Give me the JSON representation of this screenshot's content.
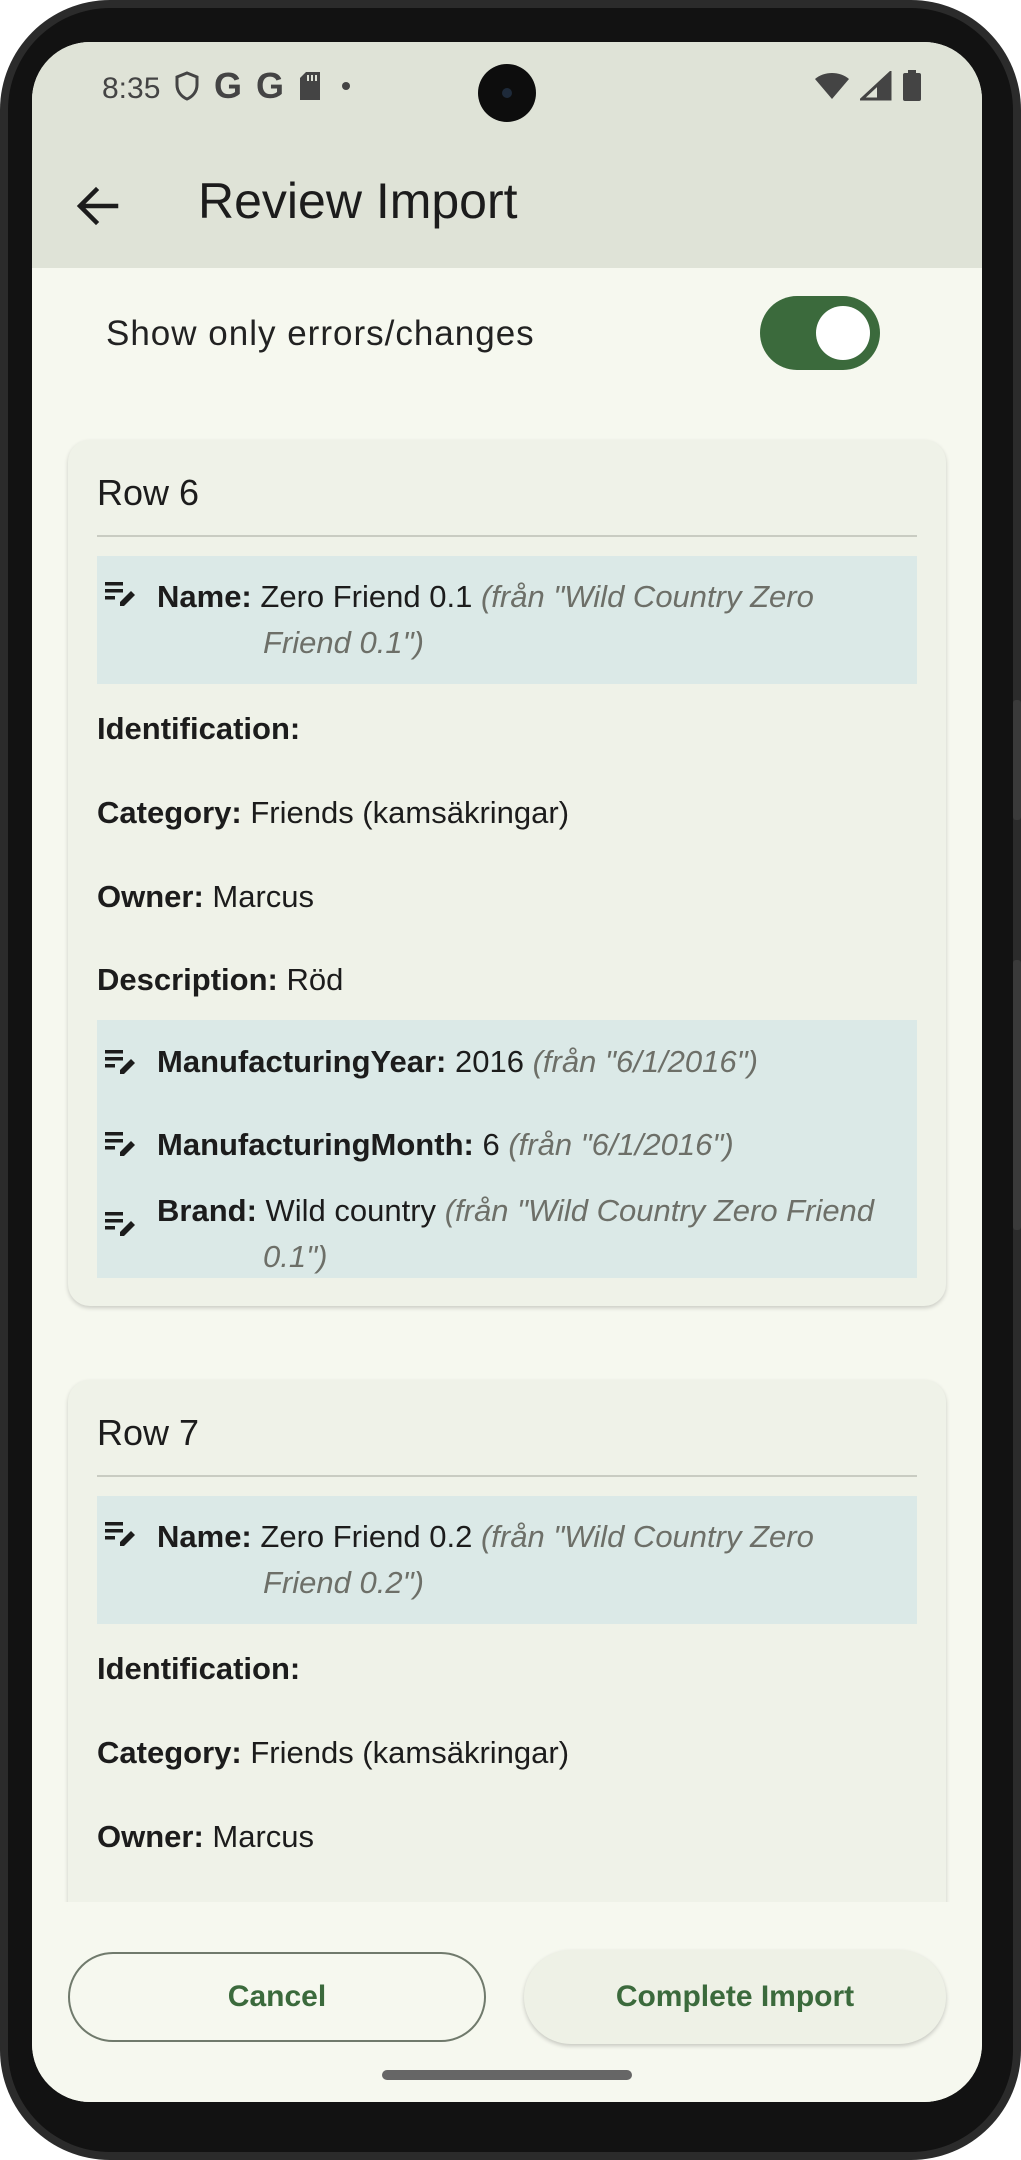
{
  "status_bar": {
    "time": "8:35",
    "left_icons": [
      "shield-icon",
      "google-icon",
      "google-icon",
      "sd-card-icon",
      "dot-icon"
    ],
    "right_icons": [
      "wifi-icon",
      "signal-icon",
      "battery-icon"
    ]
  },
  "app_bar": {
    "title": "Review Import",
    "back_icon": "arrow-back-icon"
  },
  "filter": {
    "label": "Show only errors/changes",
    "enabled": true,
    "accent_color": "#3b6a3c"
  },
  "rows": [
    {
      "title": "Row 6",
      "fields": [
        {
          "label": "Name:",
          "value": "Zero Friend 0.1",
          "original": "(från \"Wild Country Zero",
          "original_cont": "Friend 0.1\")",
          "changed": true
        },
        {
          "label": "Identification:",
          "value": "",
          "changed": false
        },
        {
          "label": "Category:",
          "value": "Friends (kamsäkringar)",
          "changed": false
        },
        {
          "label": "Owner:",
          "value": "Marcus",
          "changed": false
        },
        {
          "label": "Description:",
          "value": "Röd",
          "changed": false
        },
        {
          "label": "ManufacturingYear:",
          "value": "2016",
          "original": "(från \"6/1/2016\")",
          "changed": true
        },
        {
          "label": "ManufacturingMonth:",
          "value": "6",
          "original": "(från \"6/1/2016\")",
          "changed": true
        },
        {
          "label": "Brand:",
          "value": "Wild country",
          "original": "(från \"Wild Country Zero Friend",
          "original_cont": "0.1\")",
          "changed": true
        }
      ]
    },
    {
      "title": "Row 7",
      "fields": [
        {
          "label": "Name:",
          "value": "Zero Friend 0.2",
          "original": "(från \"Wild Country Zero",
          "original_cont": "Friend 0.2\")",
          "changed": true
        },
        {
          "label": "Identification:",
          "value": "",
          "changed": false
        },
        {
          "label": "Category:",
          "value": "Friends (kamsäkringar)",
          "changed": false
        },
        {
          "label": "Owner:",
          "value": "Marcus",
          "changed": false
        }
      ]
    }
  ],
  "actions": {
    "cancel_label": "Cancel",
    "complete_label": "Complete Import"
  },
  "colors": {
    "changed_bg": "#dbe9e7",
    "card_bg": "#eff2e8",
    "app_bar_bg": "#dfe3d7"
  }
}
